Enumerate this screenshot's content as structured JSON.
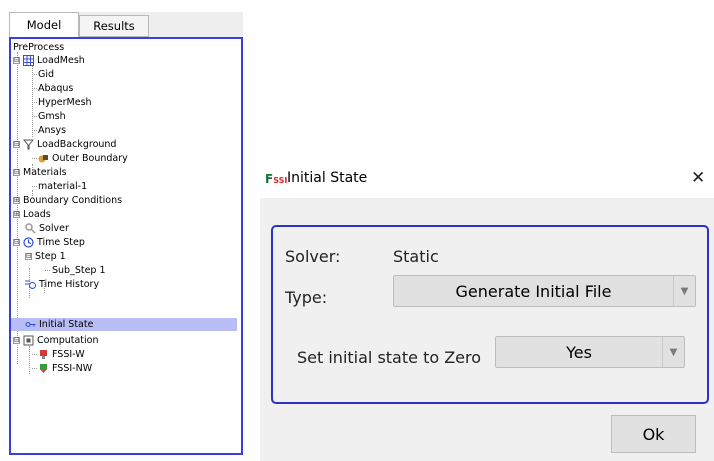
{
  "tabs": {
    "model": "Model",
    "results": "Results"
  },
  "tree": {
    "root": "PreProcess",
    "load_mesh": "LoadMesh",
    "mesh_children": [
      "Gid",
      "Abaqus",
      "HyperMesh",
      "Gmsh",
      "Ansys"
    ],
    "load_background": "LoadBackground",
    "outer_boundary": "Outer Boundary",
    "materials": "Materials",
    "material_1": "material-1",
    "boundary_conditions": "Boundary Conditions",
    "loads": "Loads",
    "solver": "Solver",
    "time_step": "Time Step",
    "step_1": "Step 1",
    "sub_step_1": "Sub_Step 1",
    "time_history": "Time History",
    "initial_state": "Initial State",
    "computation": "Computation",
    "fssi_w": "FSSI-W",
    "fssi_nw": "FSSI-NW",
    "expanders": {
      "expanded": "⊟",
      "collapsed": "⊞"
    }
  },
  "dialog": {
    "logo_f": "F",
    "logo_ssi": "SSI",
    "title": "Initial State",
    "close": "✕",
    "solver_label": "Solver:",
    "solver_value": "Static",
    "type_label": "Type:",
    "type_value": "Generate Initial File",
    "zero_label": "Set initial state to Zero",
    "zero_value": "Yes",
    "ok": "Ok",
    "dropdown_arrow": "▼"
  },
  "colors": {
    "focus_border": "#2a32c8",
    "selection": "#b9bdf5"
  }
}
